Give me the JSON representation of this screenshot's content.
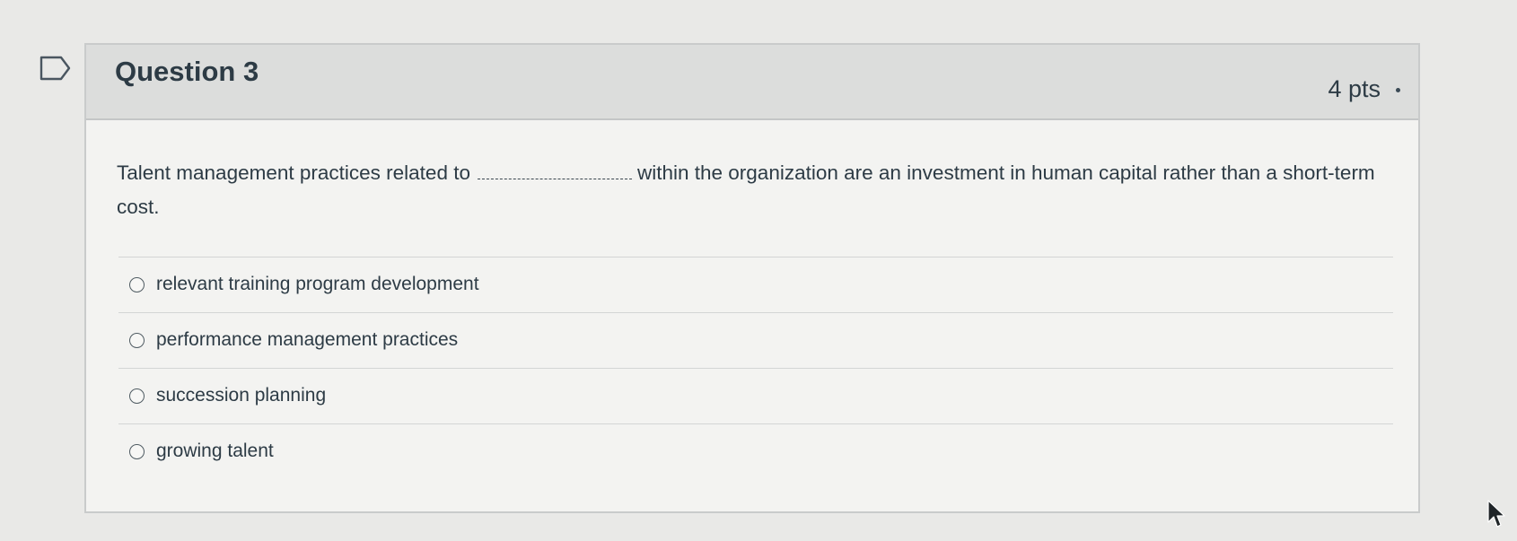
{
  "question": {
    "title": "Question 3",
    "points": "4 pts",
    "text_before_blank": "Talent management practices related to",
    "text_after_blank": "within the organization are an investment in human capital rather than a short-term cost."
  },
  "answers": [
    {
      "label": "relevant training program development",
      "selected": false
    },
    {
      "label": "performance management practices",
      "selected": false
    },
    {
      "label": "succession planning",
      "selected": false
    },
    {
      "label": "growing talent",
      "selected": false
    }
  ],
  "icons": {
    "bookmark": "bookmark-flag-icon",
    "radio": "radio-button-icon",
    "cursor": "mouse-cursor-icon"
  },
  "colors": {
    "text": "#2d3b45",
    "header_bg": "#dcdddc",
    "card_bg": "#f3f3f1",
    "page_bg": "#e9e9e7"
  }
}
